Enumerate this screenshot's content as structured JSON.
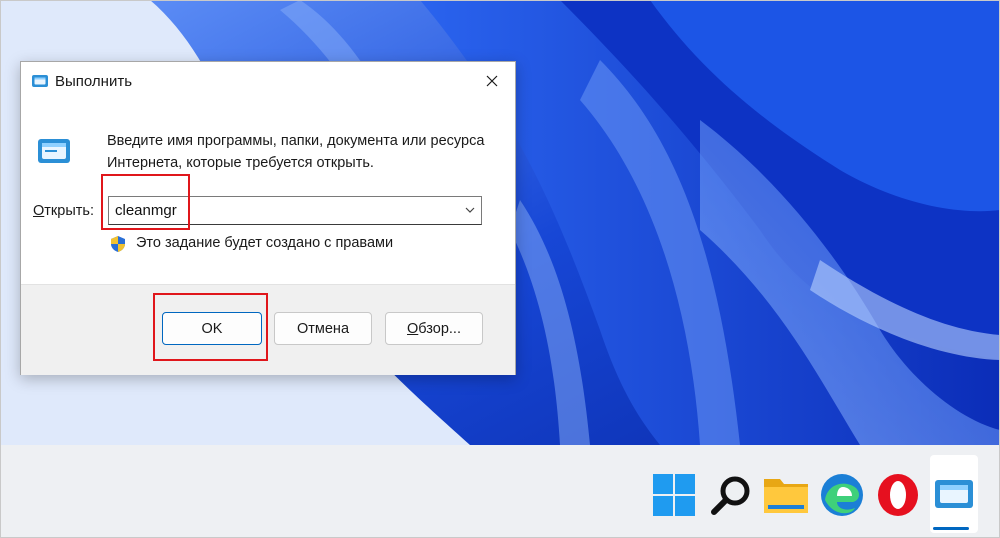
{
  "dialog": {
    "title": "Выполнить",
    "description": "Введите имя программы, папки, документа или ресурса Интернета, которые требуется открыть.",
    "open_label_accel": "О",
    "open_label_rest": "ткрыть:",
    "command_value": "cleanmgr",
    "admin_note": "Это задание будет создано с правами",
    "buttons": {
      "ok": "OK",
      "cancel": "Отмена",
      "browse_accel": "О",
      "browse_rest": "бзор..."
    }
  },
  "taskbar": {
    "items": [
      "windows-start-icon",
      "search-icon",
      "file-explorer-icon",
      "edge-icon",
      "opera-icon",
      "run-icon"
    ],
    "active_item": "run-icon"
  },
  "colors": {
    "accent": "#0067c0",
    "highlight": "#e0161b",
    "wallpaper_blue": "#1a4fd8"
  }
}
